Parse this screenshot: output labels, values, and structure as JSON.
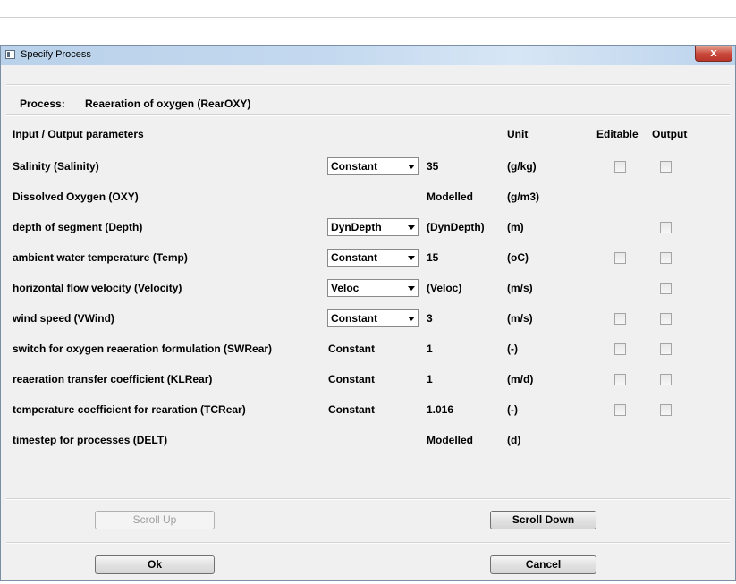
{
  "window": {
    "title": "Specify Process",
    "close_glyph": "x"
  },
  "process": {
    "label": "Process:",
    "name": "Reaeration of oxygen (RearOXY)"
  },
  "headers": {
    "parameters": "Input / Output parameters",
    "unit": "Unit",
    "editable": "Editable",
    "output": "Output"
  },
  "rows": [
    {
      "name": "Salinity (Salinity)",
      "source": "Constant",
      "source_dropdown": true,
      "value": "35",
      "unit": "(g/kg)",
      "editable_checkbox": true,
      "output_checkbox": true,
      "editable_checked": false,
      "output_checked": false
    },
    {
      "name": "Dissolved Oxygen (OXY)",
      "source": "",
      "source_dropdown": false,
      "value": "Modelled",
      "unit": "(g/m3)",
      "editable_checkbox": false,
      "output_checkbox": false
    },
    {
      "name": "depth of segment (Depth)",
      "source": "DynDepth",
      "source_dropdown": true,
      "value": "(DynDepth)",
      "unit": "(m)",
      "editable_checkbox": false,
      "output_checkbox": true,
      "output_checked": false
    },
    {
      "name": "ambient water temperature (Temp)",
      "source": "Constant",
      "source_dropdown": true,
      "value": "15",
      "unit": "(oC)",
      "editable_checkbox": true,
      "output_checkbox": true,
      "editable_checked": false,
      "output_checked": false
    },
    {
      "name": "horizontal flow velocity (Velocity)",
      "source": "Veloc",
      "source_dropdown": true,
      "value": "(Veloc)",
      "unit": "(m/s)",
      "editable_checkbox": false,
      "output_checkbox": true,
      "output_checked": false
    },
    {
      "name": "wind speed (VWind)",
      "source": "Constant",
      "source_dropdown": true,
      "value": "3",
      "unit": "(m/s)",
      "editable_checkbox": true,
      "output_checkbox": true,
      "editable_checked": false,
      "output_checked": false
    },
    {
      "name": "switch for oxygen reaeration formulation  (SWRear)",
      "source": "Constant",
      "source_dropdown": false,
      "value": "1",
      "unit": "(-)",
      "editable_checkbox": true,
      "output_checkbox": true,
      "editable_checked": false,
      "output_checked": false
    },
    {
      "name": "reaeration transfer coefficient (KLRear)",
      "source": "Constant",
      "source_dropdown": false,
      "value": "1",
      "unit": "(m/d)",
      "editable_checkbox": true,
      "output_checkbox": true,
      "editable_checked": false,
      "output_checked": false
    },
    {
      "name": "temperature coefficient for rearation (TCRear)",
      "source": "Constant",
      "source_dropdown": false,
      "value": "1.016",
      "unit": "(-)",
      "editable_checkbox": true,
      "output_checkbox": true,
      "editable_checked": false,
      "output_checked": false
    },
    {
      "name": "timestep for processes (DELT)",
      "source": "",
      "source_dropdown": false,
      "value": "Modelled",
      "unit": "(d)",
      "editable_checkbox": false,
      "output_checkbox": false
    }
  ],
  "buttons": {
    "scroll_up": "Scroll Up",
    "scroll_up_enabled": false,
    "scroll_down": "Scroll Down",
    "ok": "Ok",
    "cancel": "Cancel"
  }
}
